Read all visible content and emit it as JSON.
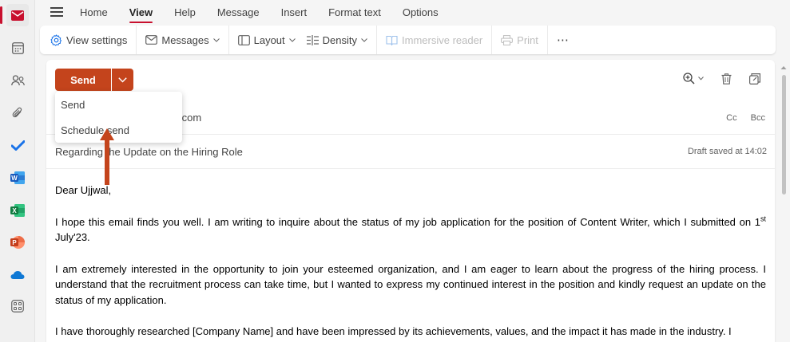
{
  "nav": {
    "tabs": [
      "Home",
      "View",
      "Help",
      "Message",
      "Insert",
      "Format text",
      "Options"
    ],
    "active_tab": "View"
  },
  "ribbon": {
    "view_settings": "View settings",
    "messages": "Messages",
    "layout": "Layout",
    "density": "Density",
    "immersive_reader": "Immersive reader",
    "print": "Print",
    "more": "⋯"
  },
  "compose": {
    "send_label": "Send",
    "to_partial": "ail.com",
    "cc_label": "Cc",
    "bcc_label": "Bcc",
    "subject": "Regarding the Update on the Hiring Role",
    "draft_status": "Draft saved at 14:02"
  },
  "send_menu": {
    "items": [
      "Send",
      "Schedule send"
    ]
  },
  "body": {
    "greeting": "Dear Ujjwal,",
    "p1_a": "I hope this email finds you well. I am writing to inquire about the status of my job application for the position of Content Writer, which I submitted on 1",
    "p1_sup": "st",
    "p1_b": " July'23.",
    "p2": "I am extremely interested in the opportunity to join your esteemed organization, and I am eager to learn about the progress of the hiring process. I understand that the recruitment process can take time, but I wanted to express my continued interest in the position and kindly request an update on the status of my application.",
    "p3": "I have thoroughly researched [Company Name] and have been impressed by its achievements, values, and the impact it has made in the industry. I"
  },
  "colors": {
    "accent": "#c8102e",
    "send_button": "#c4441c",
    "annotation_arrow": "#c4441c"
  },
  "icons": {
    "rail": [
      "mail-icon",
      "calendar-icon",
      "people-icon",
      "attachment-icon",
      "todo-icon",
      "word-icon",
      "excel-icon",
      "powerpoint-icon",
      "onedrive-icon",
      "more-apps-icon"
    ]
  }
}
